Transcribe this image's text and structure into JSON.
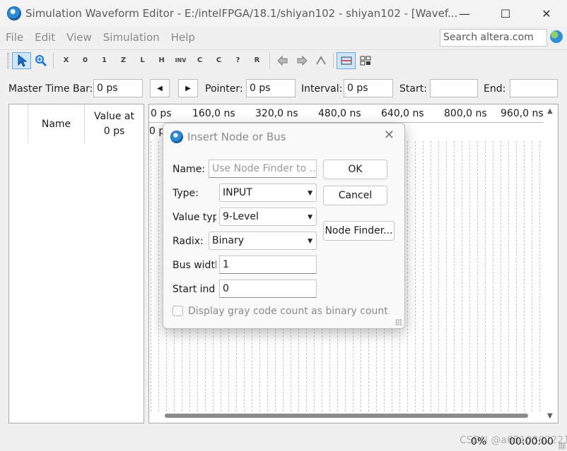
{
  "window": {
    "title": "Simulation Waveform Editor - E:/intelFPGA/18.1/shiyan102 - shiyan102 - [Wavef...",
    "minimize_glyph": "—",
    "maximize_glyph": "☐",
    "close_glyph": "✕"
  },
  "menu": {
    "items": [
      "File",
      "Edit",
      "View",
      "Simulation",
      "Help"
    ],
    "search_placeholder": "Search altera.com"
  },
  "toolbar": {
    "icons": [
      "pointer-icon",
      "zoom-icon",
      "unknown-x-icon",
      "forcing-low-icon",
      "forcing-high-icon",
      "high-impedance-icon",
      "weak-low-icon",
      "weak-high-icon",
      "invert-icon",
      "count-value-icon",
      "forcing-clock-icon",
      "arbitrary-value-icon",
      "random-value-icon",
      "snap-to-grid-icon",
      "snap-icon",
      "reset-icon",
      "grid-icon",
      "select-all-icon"
    ],
    "glyphs": [
      "X",
      "0",
      "1",
      "Z",
      "L",
      "H",
      "INV",
      "C",
      "C",
      "?",
      "R"
    ]
  },
  "timebar": {
    "master_label": "Master Time Bar:",
    "master_value": "0 ps",
    "prev_glyph": "◀",
    "next_glyph": "▶",
    "pointer_label": "Pointer:",
    "pointer_value": "0 ps",
    "interval_label": "Interval:",
    "interval_value": "0 ps",
    "start_label": "Start:",
    "start_value": "",
    "end_label": "End:",
    "end_value": ""
  },
  "signal_panel": {
    "name_header": "Name",
    "value_header_line1": "Value at",
    "value_header_line2": "0 ps"
  },
  "waveform": {
    "ticks": [
      "0 ps",
      "160,0 ns",
      "320,0 ns",
      "480,0 ns",
      "640,0 ns",
      "800,0 ns",
      "960,0 ns"
    ],
    "cursor_label": "0 p"
  },
  "statusbar": {
    "progress": "0%",
    "elapsed": "00:00:00",
    "watermark": "CSDN @a6510382221"
  },
  "dialog": {
    "title": "Insert Node or Bus",
    "close_glyph": "✕",
    "name_label": "Name:",
    "name_placeholder": "Use Node Finder to ...",
    "type_label": "Type:",
    "type_value": "INPUT",
    "value_type_label": "Value typ",
    "value_type_value": "9-Level",
    "radix_label": "Radix:",
    "radix_value": "Binary",
    "bus_width_label": "Bus widtl",
    "bus_width_value": "1",
    "start_index_label": "Start ind",
    "start_index_value": "0",
    "ok_label": "OK",
    "cancel_label": "Cancel",
    "node_finder_label": "Node Finder...",
    "gray_code_label": "Display gray code count as binary count",
    "gray_code_checked": false
  }
}
